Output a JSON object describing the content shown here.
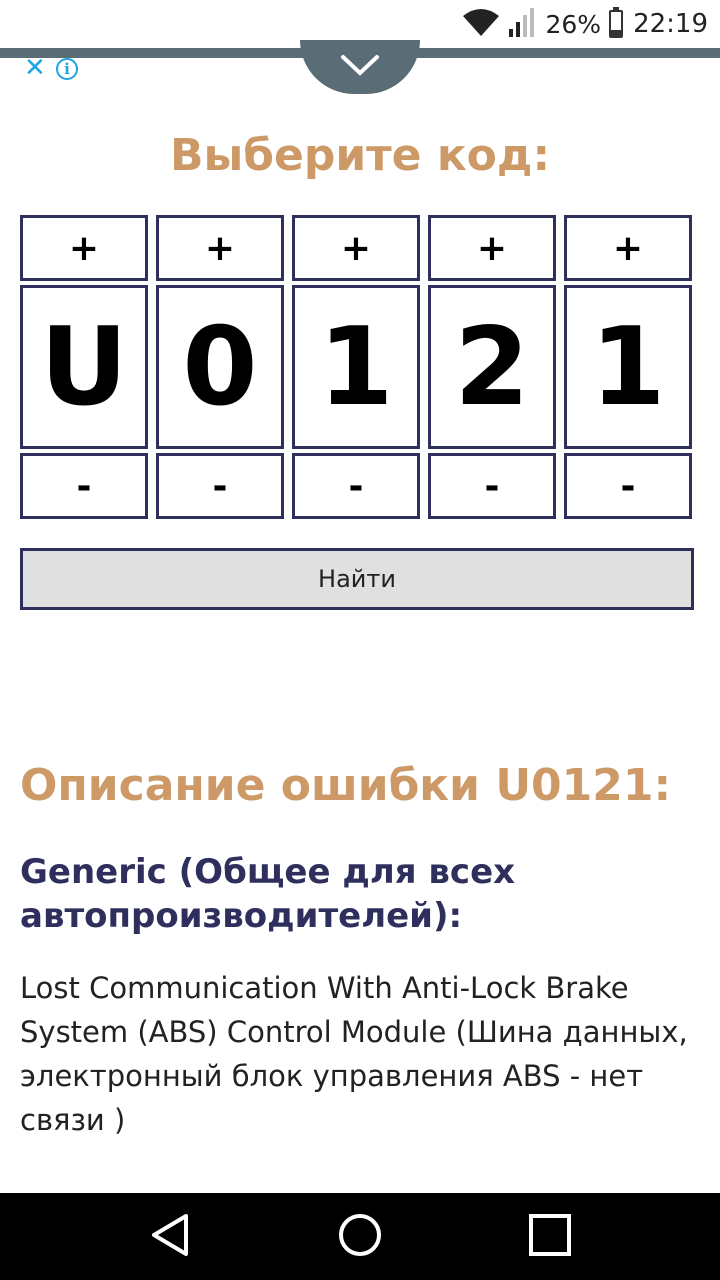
{
  "status_bar": {
    "battery_percent": "26%",
    "time": "22:19",
    "icons": [
      "wifi-icon",
      "signal-icon",
      "battery-icon"
    ],
    "battery_level": 0.26
  },
  "ad": {
    "close_icon": "✕",
    "info_icon": "i",
    "collapse_icon": "chevron-down-icon"
  },
  "title": "Выберите код:",
  "code": {
    "plus_label": "+",
    "minus_label": "-",
    "digits": [
      "U",
      "0",
      "1",
      "2",
      "1"
    ]
  },
  "find_button": "Найти",
  "description": {
    "heading": "Описание ошибки U0121:",
    "subheading": "Generic (Общее для всех автопроизводителей):",
    "text": "Lost Communication With Anti-Lock Brake System (ABS) Control Module (Шина данных, электронный блок управления ABS - нет связи )"
  },
  "nav_bar": {
    "buttons": [
      "back-icon",
      "home-icon",
      "recents-icon"
    ]
  },
  "colors": {
    "accent": "#cd9a67",
    "navy": "#2f2f5e",
    "ad_band": "#5a6d77",
    "ad_icons": "#1fa4e2"
  }
}
